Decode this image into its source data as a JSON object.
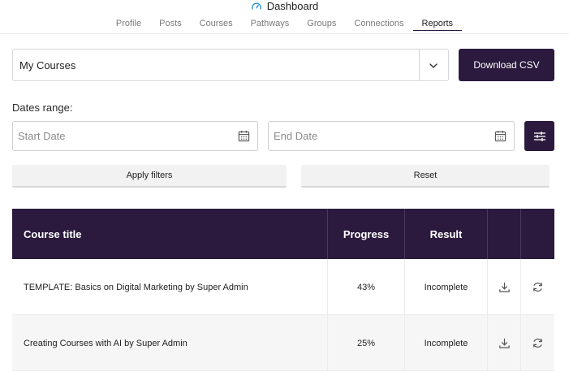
{
  "header": {
    "title": "Dashboard",
    "tabs": [
      {
        "label": "Profile"
      },
      {
        "label": "Posts"
      },
      {
        "label": "Courses"
      },
      {
        "label": "Pathways"
      },
      {
        "label": "Groups"
      },
      {
        "label": "Connections"
      },
      {
        "label": "Reports",
        "active": true
      }
    ]
  },
  "report_select": {
    "value": "My Courses"
  },
  "download_label": "Download CSV",
  "dates": {
    "label": "Dates range:",
    "start_placeholder": "Start Date",
    "end_placeholder": "End Date"
  },
  "actions": {
    "apply": "Apply filters",
    "reset": "Reset"
  },
  "table": {
    "headers": {
      "title": "Course title",
      "progress": "Progress",
      "result": "Result"
    },
    "rows": [
      {
        "title": "TEMPLATE: Basics on Digital Marketing by Super Admin",
        "progress": "43%",
        "result": "Incomplete"
      },
      {
        "title": "Creating Courses with AI by Super Admin",
        "progress": "25%",
        "result": "Incomplete"
      }
    ]
  },
  "colors": {
    "accent": "#2b1a3d",
    "gauge": "#2a8fd6"
  }
}
